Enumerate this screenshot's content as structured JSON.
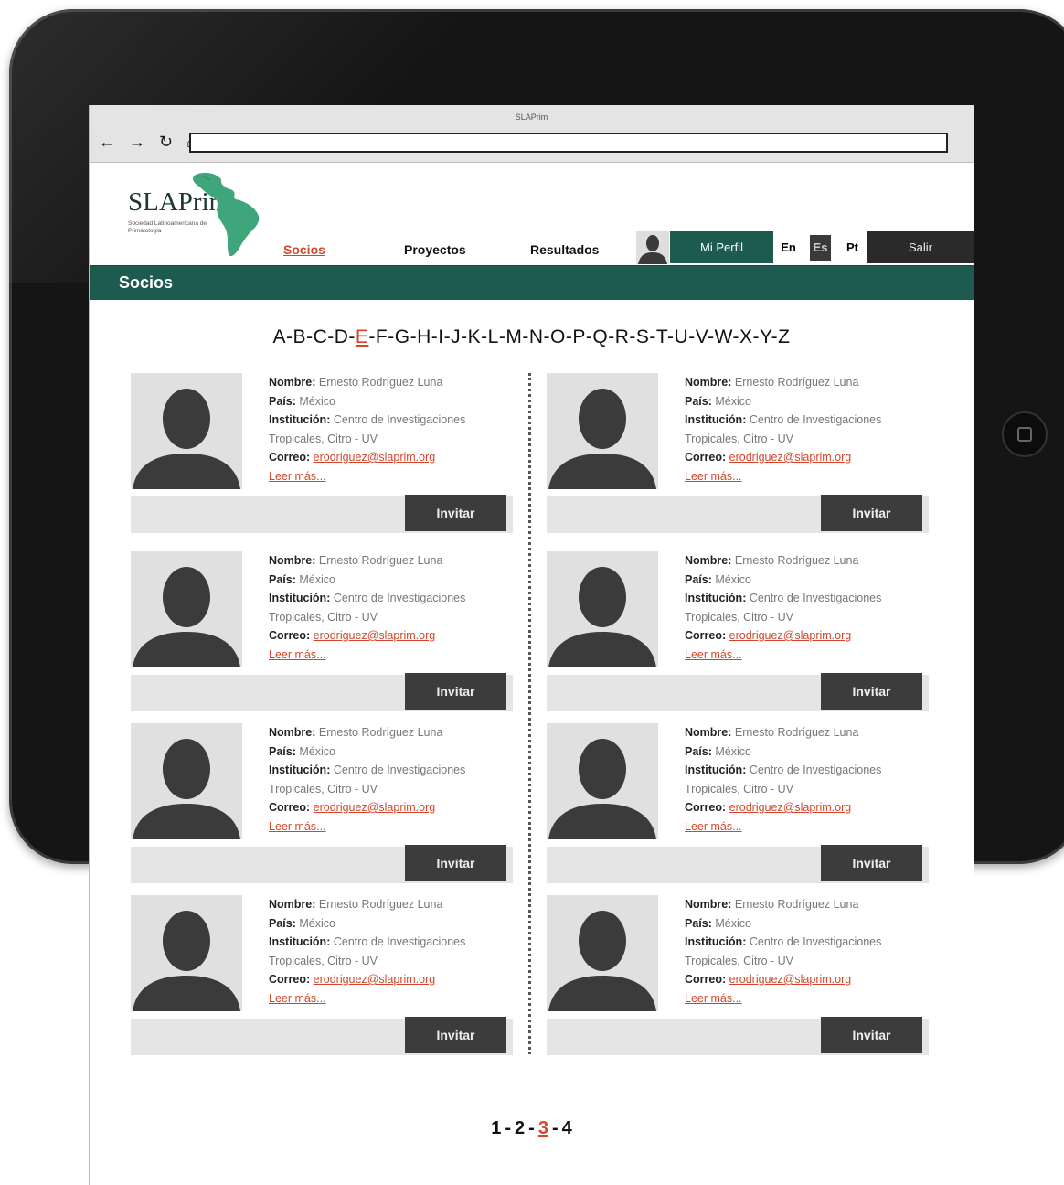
{
  "window": {
    "title": "SLAPrim"
  },
  "toolbar": {
    "back": "←",
    "forward": "→",
    "refresh": "↻",
    "home": "⌂"
  },
  "logo": {
    "title": "SLAPrim",
    "subtitle": "Sociedad Latinoamericana de Primatología"
  },
  "nav": [
    {
      "label": "Socios",
      "active": true
    },
    {
      "label": "Proyectos",
      "active": false
    },
    {
      "label": "Resultados",
      "active": false
    }
  ],
  "profile": {
    "label": "Mi Perfil"
  },
  "languages": [
    {
      "code": "En",
      "selected": false
    },
    {
      "code": "Es",
      "selected": true
    },
    {
      "code": "Pt",
      "selected": false
    }
  ],
  "logout": {
    "label": "Salir"
  },
  "section": {
    "title": "Socios"
  },
  "alphabet": {
    "letters": [
      "A",
      "B",
      "C",
      "D",
      "E",
      "F",
      "G",
      "H",
      "I",
      "J",
      "K",
      "L",
      "M",
      "N",
      "O",
      "P",
      "Q",
      "R",
      "S",
      "T",
      "U",
      "V",
      "W",
      "X",
      "Y",
      "Z"
    ],
    "active": "E",
    "separator": "-"
  },
  "labels": {
    "name": "Nombre:",
    "country": "País:",
    "institution": "Institución:",
    "email": "Correo:",
    "read_more": "Leer más...",
    "invite": "Invitar"
  },
  "members": [
    {
      "name": "Ernesto Rodríguez Luna",
      "country": "México",
      "institution_line1": "Centro de Investigaciones",
      "institution_line2": "Tropicales, Citro - UV",
      "email": "erodriguez@slaprim.org"
    },
    {
      "name": "Ernesto Rodríguez Luna",
      "country": "México",
      "institution_line1": "Centro de Investigaciones",
      "institution_line2": "Tropicales, Citro - UV",
      "email": "erodriguez@slaprim.org"
    },
    {
      "name": "Ernesto Rodríguez Luna",
      "country": "México",
      "institution_line1": "Centro de Investigaciones",
      "institution_line2": "Tropicales, Citro - UV",
      "email": "erodriguez@slaprim.org"
    },
    {
      "name": "Ernesto Rodríguez Luna",
      "country": "México",
      "institution_line1": "Centro de Investigaciones",
      "institution_line2": "Tropicales, Citro - UV",
      "email": "erodriguez@slaprim.org"
    },
    {
      "name": "Ernesto Rodríguez Luna",
      "country": "México",
      "institution_line1": "Centro de Investigaciones",
      "institution_line2": "Tropicales, Citro - UV",
      "email": "erodriguez@slaprim.org"
    },
    {
      "name": "Ernesto Rodríguez Luna",
      "country": "México",
      "institution_line1": "Centro de Investigaciones",
      "institution_line2": "Tropicales, Citro - UV",
      "email": "erodriguez@slaprim.org"
    },
    {
      "name": "Ernesto Rodríguez Luna",
      "country": "México",
      "institution_line1": "Centro de Investigaciones",
      "institution_line2": "Tropicales, Citro - UV",
      "email": "erodriguez@slaprim.org"
    },
    {
      "name": "Ernesto Rodríguez Luna",
      "country": "México",
      "institution_line1": "Centro de Investigaciones",
      "institution_line2": "Tropicales, Citro - UV",
      "email": "erodriguez@slaprim.org"
    }
  ],
  "pagination": {
    "pages": [
      "1",
      "2",
      "3",
      "4"
    ],
    "current": "3",
    "separator": "-"
  },
  "colors": {
    "brand": "#1d5b51",
    "accent": "#d5452b",
    "dark": "#2a2a2a"
  }
}
